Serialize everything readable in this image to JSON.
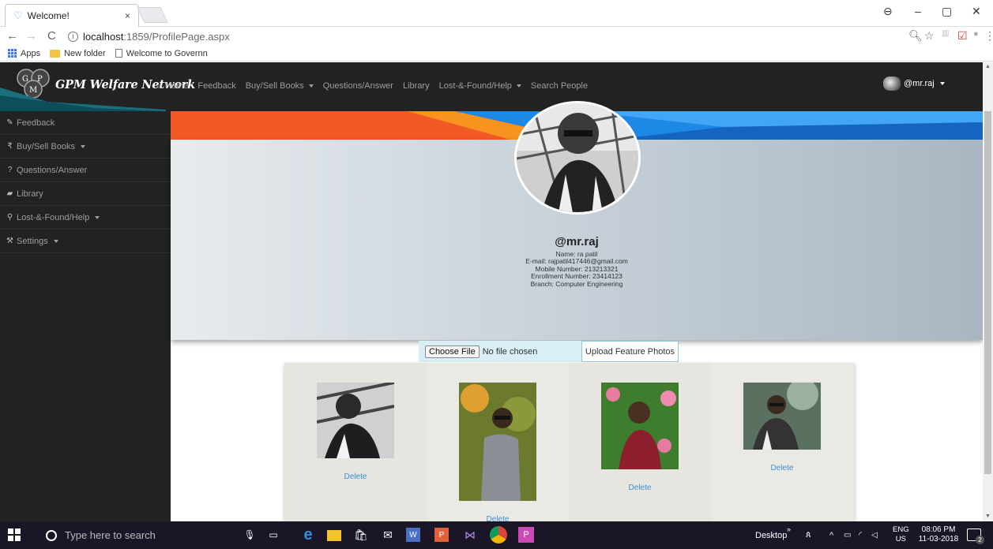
{
  "browser": {
    "tab_title": "Welcome!",
    "tab_close": "×",
    "url_host": "localhost",
    "url_rest": ":1859/ProfilePage.aspx",
    "bookmarks": [
      "Apps",
      "New folder",
      "Welcome to Governn"
    ]
  },
  "site": {
    "brand": "GPM Welfare Network",
    "nav": [
      "Home",
      "Feedback",
      "Buy/Sell Books",
      "Questions/Answer",
      "Library",
      "Lost-&-Found/Help",
      "Search People"
    ],
    "user": "@mr.raj"
  },
  "sidebar": {
    "items": [
      {
        "label": "Feedback",
        "icon": "pencil-icon"
      },
      {
        "label": "Buy/Sell Books",
        "icon": "rupee-icon",
        "dropdown": true
      },
      {
        "label": "Questions/Answer",
        "icon": "question-icon"
      },
      {
        "label": "Library",
        "icon": "book-icon"
      },
      {
        "label": "Lost-&-Found/Help",
        "icon": "map-marker-icon",
        "dropdown": true
      },
      {
        "label": "Settings",
        "icon": "wrench-icon",
        "dropdown": true
      }
    ]
  },
  "profile": {
    "username": "@mr.raj",
    "name": "Name: ra patil",
    "email": "E-mail: rajpatil417446@gmail.com",
    "mobile": "Mobile Number: 213213321",
    "enrollment": "Enrollment Number: 23414123",
    "branch": "Branch: Computer Engineering"
  },
  "upload": {
    "choose_label": "Choose File",
    "no_file": "No file chosen",
    "upload_label": "Upload Feature Photos"
  },
  "gallery": {
    "delete_label": "Delete"
  },
  "taskbar": {
    "search_placeholder": "Type here to search",
    "desktop": "Desktop",
    "lang_top": "ENG",
    "lang_bottom": "US",
    "time": "08:06 PM",
    "date": "11-03-2018",
    "notif_count": "2"
  },
  "colors": {
    "navbar": "#222222",
    "link": "#3b8fd9",
    "banner_orange": "#f15a24",
    "banner_blue": "#1e88e5"
  }
}
